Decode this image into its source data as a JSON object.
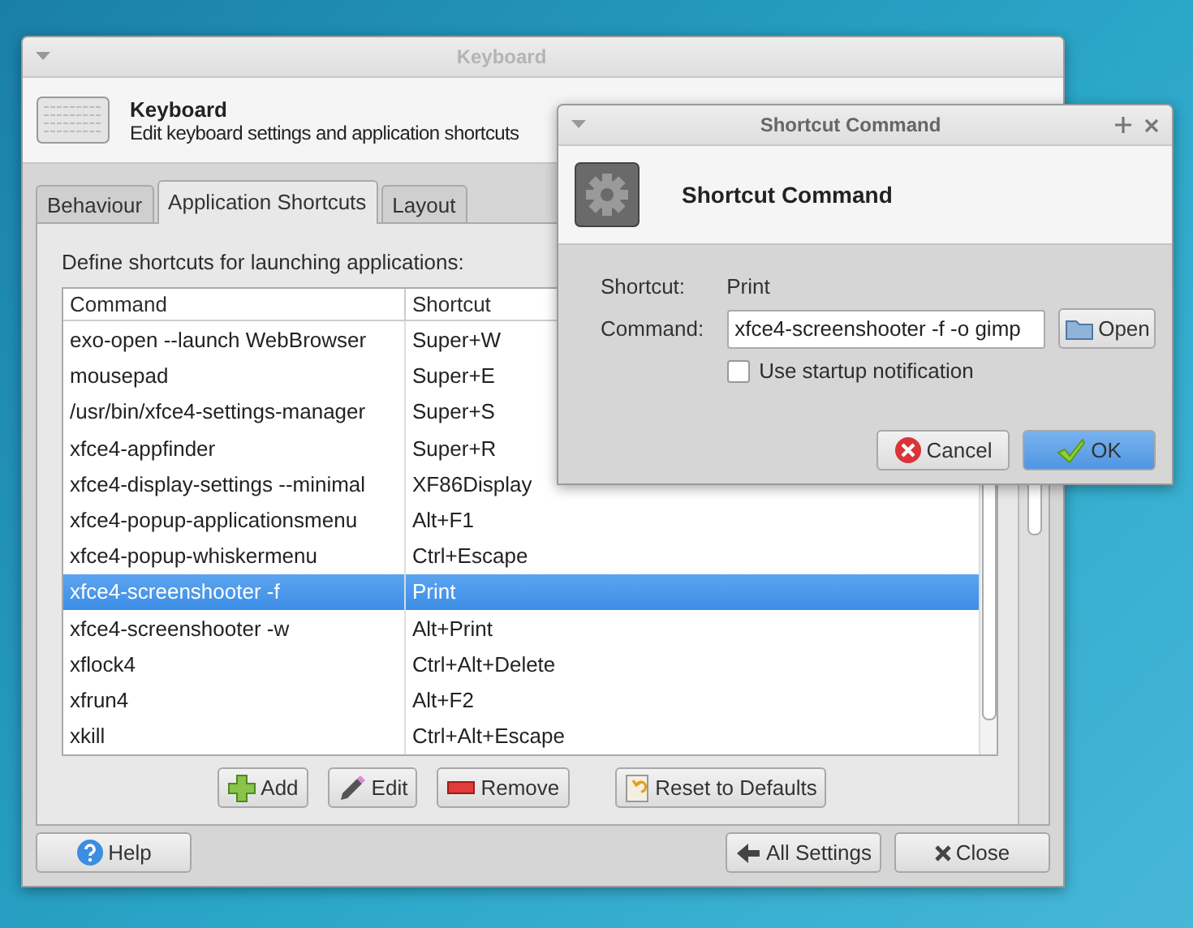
{
  "main_window": {
    "title": "Keyboard",
    "header": {
      "title": "Keyboard",
      "subtitle": "Edit keyboard settings and application shortcuts"
    },
    "tabs": [
      {
        "label": "Behaviour",
        "selected": false
      },
      {
        "label": "Application Shortcuts",
        "selected": true
      },
      {
        "label": "Layout",
        "selected": false
      }
    ],
    "intro": "Define shortcuts for launching applications:",
    "table": {
      "columns": [
        "Command",
        "Shortcut"
      ],
      "rows": [
        {
          "command": "exo-open --launch WebBrowser",
          "shortcut": "Super+W",
          "selected": false
        },
        {
          "command": "mousepad",
          "shortcut": "Super+E",
          "selected": false
        },
        {
          "command": "/usr/bin/xfce4-settings-manager",
          "shortcut": "Super+S",
          "selected": false
        },
        {
          "command": "xfce4-appfinder",
          "shortcut": "Super+R",
          "selected": false
        },
        {
          "command": "xfce4-display-settings --minimal",
          "shortcut": "XF86Display",
          "selected": false
        },
        {
          "command": "xfce4-popup-applicationsmenu",
          "shortcut": "Alt+F1",
          "selected": false
        },
        {
          "command": "xfce4-popup-whiskermenu",
          "shortcut": "Ctrl+Escape",
          "selected": false
        },
        {
          "command": "xfce4-screenshooter -f",
          "shortcut": "Print",
          "selected": true
        },
        {
          "command": "xfce4-screenshooter -w",
          "shortcut": "Alt+Print",
          "selected": false
        },
        {
          "command": "xflock4",
          "shortcut": "Ctrl+Alt+Delete",
          "selected": false
        },
        {
          "command": "xfrun4",
          "shortcut": "Alt+F2",
          "selected": false
        },
        {
          "command": "xkill",
          "shortcut": "Ctrl+Alt+Escape",
          "selected": false
        }
      ]
    },
    "actions": [
      {
        "label": "Add",
        "kind": "add"
      },
      {
        "label": "Edit",
        "kind": "edit"
      },
      {
        "label": "Remove",
        "kind": "remove"
      },
      {
        "label": "Reset to Defaults",
        "kind": "reset"
      }
    ],
    "footer": {
      "help": "Help",
      "buttons": [
        {
          "label": "All Settings",
          "kind": "back"
        },
        {
          "label": "Close",
          "kind": "close"
        }
      ]
    }
  },
  "dialog": {
    "title": "Shortcut Command",
    "header": "Shortcut Command",
    "shortcut_label": "Shortcut:",
    "shortcut_value": "Print",
    "command_label": "Command:",
    "command_value": "xfce4-screenshooter -f -o gimp",
    "open_button": "Open",
    "startup_notification": {
      "label": "Use startup notification",
      "checked": false
    },
    "buttons": [
      {
        "label": "Cancel",
        "kind": "cancel"
      },
      {
        "label": "OK",
        "kind": "ok"
      }
    ]
  }
}
